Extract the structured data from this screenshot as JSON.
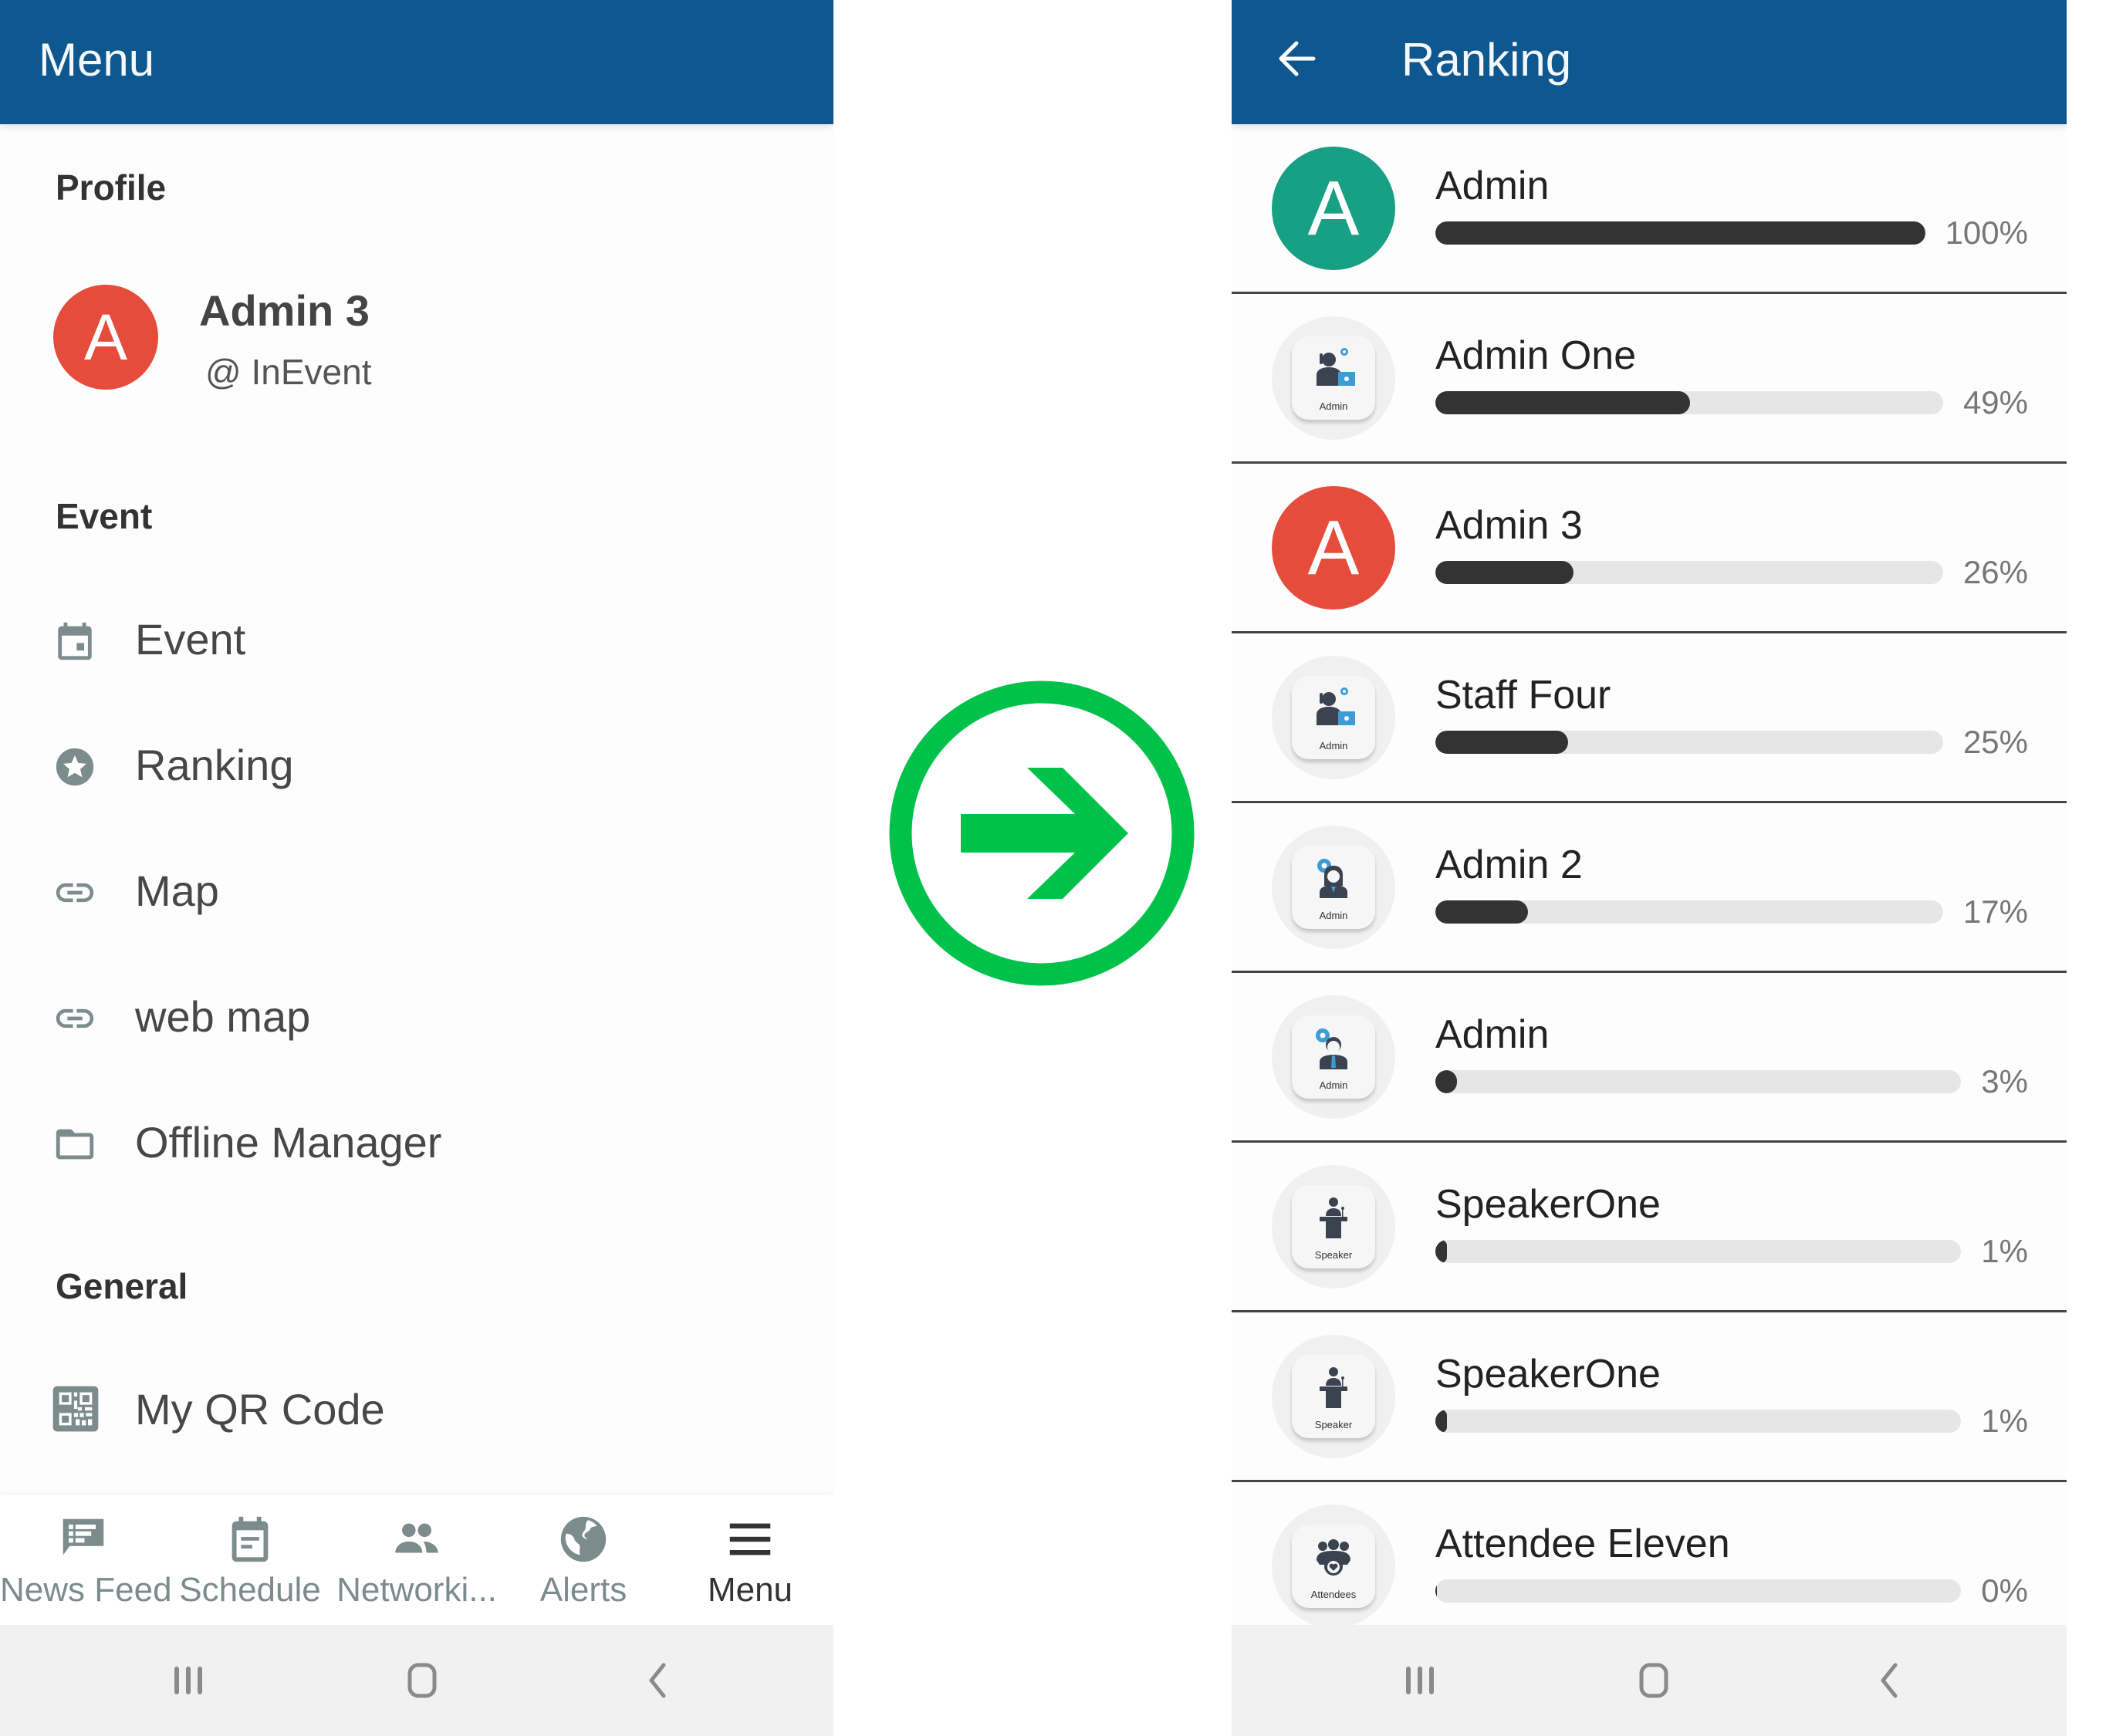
{
  "colors": {
    "appbar": "#0F578F",
    "accent_green": "#00C24B",
    "avatar_red": "#E64C3C",
    "avatar_teal": "#18A085",
    "bar_fill": "#333333",
    "bar_track": "#E6E6E6",
    "icon_gray": "#7C8B8B"
  },
  "left": {
    "title": "Menu",
    "sections": {
      "profile": "Profile",
      "event": "Event",
      "general": "General"
    },
    "profile": {
      "avatar_letter": "A",
      "name": "Admin 3",
      "org": "@ InEvent"
    },
    "menu_items": [
      {
        "label": "Event",
        "icon": "calendar-icon"
      },
      {
        "label": "Ranking",
        "icon": "star-circle-icon"
      },
      {
        "label": "Map",
        "icon": "link-icon"
      },
      {
        "label": "web map",
        "icon": "link-icon"
      },
      {
        "label": "Offline Manager",
        "icon": "folder-icon"
      },
      {
        "label": "My QR Code",
        "icon": "qr-code-icon"
      }
    ],
    "bottom_nav": [
      {
        "label": "News Feed",
        "icon": "news-feed-icon",
        "active": false
      },
      {
        "label": "Schedule",
        "icon": "schedule-icon",
        "active": false
      },
      {
        "label": "Networki...",
        "icon": "people-icon",
        "active": false
      },
      {
        "label": "Alerts",
        "icon": "globe-icon",
        "active": false
      },
      {
        "label": "Menu",
        "icon": "hamburger-icon",
        "active": true
      }
    ]
  },
  "transition": {
    "icon": "arrow-right-circle-icon"
  },
  "right": {
    "title": "Ranking",
    "back_icon": "arrow-back-icon",
    "ranking": [
      {
        "name": "Admin",
        "percent": 100,
        "percent_label": "100%",
        "avatar": {
          "type": "letter",
          "letter": "A",
          "color": "#18A085"
        }
      },
      {
        "name": "Admin One",
        "percent": 49,
        "percent_label": "49%",
        "avatar": {
          "type": "image",
          "caption": "Admin",
          "icon": "admin-female-laptop-icon"
        }
      },
      {
        "name": "Admin 3",
        "percent": 26,
        "percent_label": "26%",
        "avatar": {
          "type": "letter",
          "letter": "A",
          "color": "#E64C3C"
        }
      },
      {
        "name": "Staff Four",
        "percent": 25,
        "percent_label": "25%",
        "avatar": {
          "type": "image",
          "caption": "Admin",
          "icon": "admin-female-laptop-icon"
        }
      },
      {
        "name": "Admin 2",
        "percent": 17,
        "percent_label": "17%",
        "avatar": {
          "type": "image",
          "caption": "Admin",
          "icon": "admin-female-gear-icon"
        }
      },
      {
        "name": "Admin",
        "percent": 3,
        "percent_label": "3%",
        "avatar": {
          "type": "image",
          "caption": "Admin",
          "icon": "admin-male-gear-icon"
        }
      },
      {
        "name": "SpeakerOne",
        "percent": 1,
        "percent_label": "1%",
        "avatar": {
          "type": "image",
          "caption": "Speaker",
          "icon": "speaker-podium-icon"
        }
      },
      {
        "name": "SpeakerOne",
        "percent": 1,
        "percent_label": "1%",
        "avatar": {
          "type": "image",
          "caption": "Speaker",
          "icon": "speaker-podium-icon"
        }
      },
      {
        "name": "Attendee Eleven",
        "percent": 0,
        "percent_label": "0%",
        "avatar": {
          "type": "image",
          "caption": "Attendees",
          "icon": "attendees-group-icon"
        }
      }
    ]
  },
  "system_nav": [
    {
      "icon": "recent-apps-icon"
    },
    {
      "icon": "home-icon"
    },
    {
      "icon": "system-back-icon"
    }
  ]
}
